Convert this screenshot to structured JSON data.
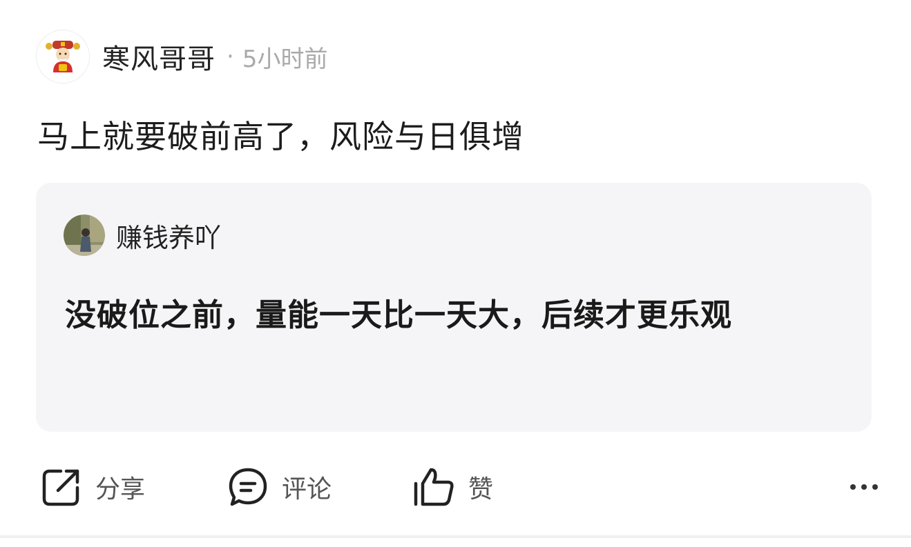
{
  "post": {
    "author": {
      "name": "寒风哥哥",
      "separator": "·",
      "time": "5小时前",
      "avatar_icon": "god-of-wealth-avatar"
    },
    "content": "马上就要破前高了，风险与日俱增",
    "quoted": {
      "author_name": "赚钱养吖",
      "avatar_icon": "user-photo-avatar",
      "text": "没破位之前，量能一天比一天大，后续才更乐观"
    },
    "actions": {
      "share_label": "分享",
      "comment_label": "评论",
      "like_label": "赞",
      "share_icon": "share-icon",
      "comment_icon": "comment-icon",
      "like_icon": "thumbs-up-icon",
      "more_icon": "more-icon"
    }
  },
  "colors": {
    "quote_background": "#f5f5f7",
    "secondary_text": "#a9a9a9",
    "primary_text": "#222222"
  }
}
